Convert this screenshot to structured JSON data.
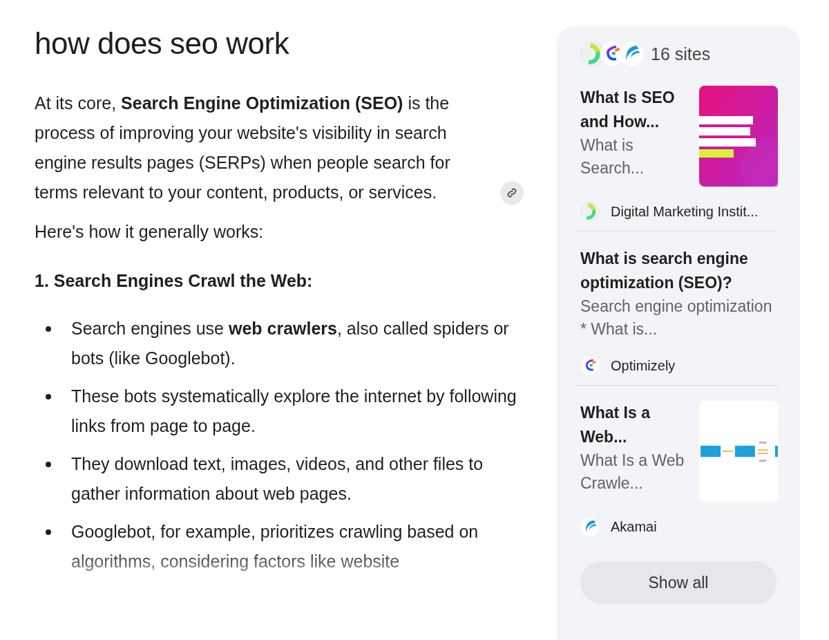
{
  "query": "how does seo work",
  "answer": {
    "intro": "At its core, **Search Engine Optimization (SEO)** is the process of improving your website's visibility in search engine results pages (SERPs) when people search for terms relevant to your content, products, or services.",
    "lead": "Here's how it generally works:",
    "section_heading": "1. Search Engines Crawl the Web:",
    "bullets": [
      "Search engines use **web crawlers**, also called spiders or bots (like Googlebot).",
      "These bots systematically explore the internet by following links from page to page.",
      "They download text, images, videos, and other files to gather information about web pages.",
      "Googlebot, for example, prioritizes crawling based on algorithms, considering factors like website"
    ]
  },
  "sources": {
    "count_label": "16 sites",
    "items": [
      {
        "title": "What Is SEO and How...",
        "snippet": "What is Search...",
        "site": "Digital Marketing Instit...",
        "logo": {
          "kind": "dmi"
        }
      },
      {
        "title": "What is search engine optimization (SEO)?",
        "snippet": "Search engine optimization * What is...",
        "site": "Optimizely",
        "logo": {
          "kind": "opt"
        }
      },
      {
        "title": "What Is a Web...",
        "snippet": "What Is a Web Crawle...",
        "site": "Akamai",
        "logo": {
          "kind": "akamai"
        }
      }
    ],
    "show_all": "Show all"
  }
}
